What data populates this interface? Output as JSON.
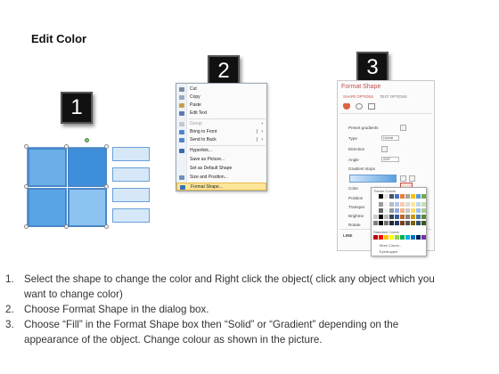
{
  "title": "Edit Color",
  "steps": [
    {
      "number": "1"
    },
    {
      "number": "2"
    },
    {
      "number": "3"
    }
  ],
  "context_menu": {
    "items": [
      {
        "label": "Cut",
        "icon": "scissors-icon",
        "disabled": false
      },
      {
        "label": "Copy",
        "icon": "copy-icon",
        "disabled": false
      },
      {
        "label": "Paste",
        "icon": "paste-icon",
        "disabled": false
      },
      {
        "label": "Edit Text",
        "icon": "edit-text-icon",
        "disabled": false
      },
      {
        "label": "Group",
        "icon": "group-icon",
        "disabled": true,
        "submenu": true
      },
      {
        "label": "Bring to Front",
        "icon": "bring-front-icon",
        "disabled": false,
        "submenu": true
      },
      {
        "label": "Send to Back",
        "icon": "send-back-icon",
        "disabled": false,
        "submenu": true
      },
      {
        "label": "Hyperlink...",
        "icon": "hyperlink-icon",
        "disabled": false
      },
      {
        "label": "Save as Picture...",
        "icon": "save-picture-icon",
        "disabled": false
      },
      {
        "label": "Set as Default Shape",
        "icon": "",
        "disabled": false
      },
      {
        "label": "Size and Position...",
        "icon": "size-icon",
        "disabled": false
      },
      {
        "label": "Format Shape...",
        "icon": "format-shape-icon",
        "disabled": false,
        "highlighted": true
      }
    ]
  },
  "format_panel": {
    "title": "Format Shape",
    "tabs": [
      "SHAPE OPTIONS",
      "TEXT OPTIONS"
    ],
    "fields": [
      {
        "label": "Preset gradients",
        "value": ""
      },
      {
        "label": "Type",
        "value": "Linear"
      },
      {
        "label": "Direction",
        "value": ""
      },
      {
        "label": "Angle",
        "value": "225°"
      },
      {
        "label": "Gradient stops",
        "value": ""
      },
      {
        "label": "Color",
        "value": ""
      },
      {
        "label": "Position",
        "value": ""
      },
      {
        "label": "Transpar",
        "value": ""
      },
      {
        "label": "Brightne",
        "value": ""
      },
      {
        "label": "Rotate",
        "value": ""
      },
      {
        "label": "LINE",
        "value": ""
      }
    ],
    "palette": {
      "theme_label": "Theme Colors",
      "standard_label": "Standard Colors",
      "more_colors": "More Colors...",
      "eyedropper": "Eyedropper",
      "theme_top": [
        "#ffffff",
        "#000000",
        "#e7e6e6",
        "#44546a",
        "#4472c4",
        "#ed7d31",
        "#a5a5a5",
        "#ffc000",
        "#5b9bd5",
        "#70ad47"
      ],
      "standard": [
        "#c00000",
        "#ff0000",
        "#ffc000",
        "#ffff00",
        "#92d050",
        "#00b050",
        "#00b0f0",
        "#0070c0",
        "#002060",
        "#7030a0"
      ]
    }
  },
  "instructions": [
    {
      "num": "1.",
      "lines": [
        "Select the shape to change the color and Right click the object( click any object which you",
        "want to change color)"
      ]
    },
    {
      "num": "2.",
      "lines": [
        "Choose Format Shape in the dialog box."
      ]
    },
    {
      "num": "3.",
      "lines": [
        "Choose “Fill” in the Format Shape box then “Solid” or “Gradient” depending on the",
        "appearance of the object. Change colour as shown in the picture."
      ]
    }
  ]
}
